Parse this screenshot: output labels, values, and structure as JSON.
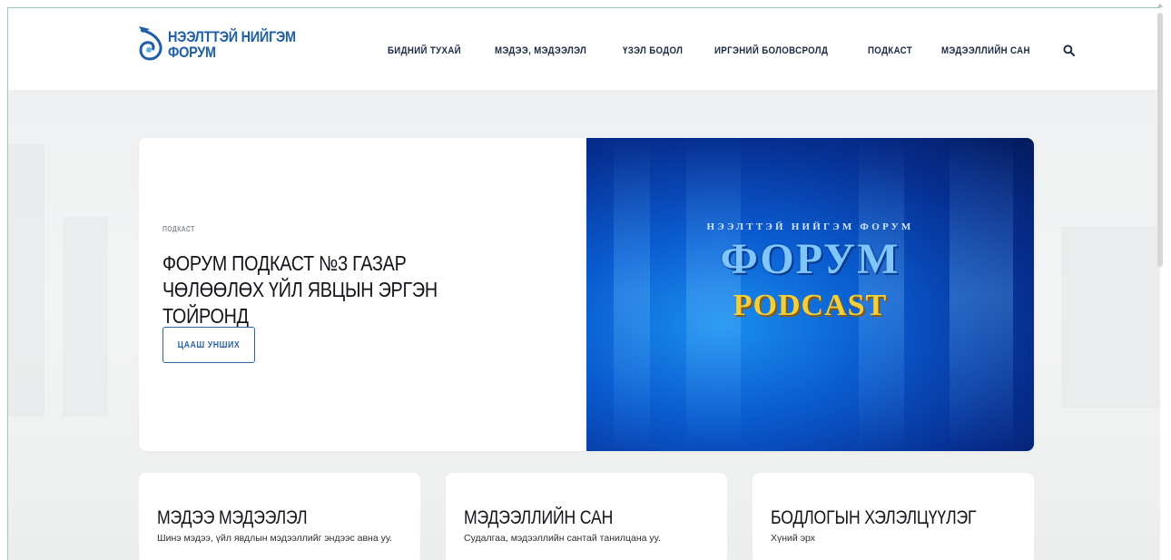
{
  "header": {
    "logo_line1": "НЭЭЛТТЭЙ НИЙГЭМ",
    "logo_line2": "ФОРУМ",
    "nav": [
      {
        "label": "БИДНИЙ ТУХАЙ"
      },
      {
        "label": "МЭДЭЭ, МЭДЭЭЛЭЛ"
      },
      {
        "label": "ҮЗЭЛ БОДОЛ"
      },
      {
        "label": "ИРГЭНИЙ БОЛОВСРОЛД"
      },
      {
        "label": "ПОДКАСТ"
      },
      {
        "label": "МЭДЭЭЛЛИЙН САН"
      }
    ],
    "search_icon": "search-icon"
  },
  "hero": {
    "kicker": "ПОДКАСТ",
    "title": "ФОРУМ ПОДКАСТ №3 ГАЗАР ЧӨЛӨӨЛӨХ ҮЙЛ ЯВЦЫН ЭРГЭН ТОЙРОНД",
    "button_label": "ЦААШ УНШИХ",
    "image": {
      "subtitle": "НЭЭЛТТЭЙ НИЙГЭМ ФОРУМ",
      "main": "ФОРУМ",
      "podcast": "PODCAST"
    }
  },
  "cards": [
    {
      "title": "МЭДЭЭ МЭДЭЭЛЭЛ",
      "text": "Шинэ мэдээ, үйл явдлын мэдээллийг эндээс авна уу."
    },
    {
      "title": "МЭДЭЭЛЛИЙН САН",
      "text": "Судалгаа, мэдээллийн сантай танилцана уу."
    },
    {
      "title": "БОДЛОГЫН ХЭЛЭЛЦҮҮЛЭГ",
      "text": "Хүний эрх"
    }
  ],
  "colors": {
    "brand": "#1f5fa8",
    "nav_text": "#1b2a44",
    "button_border": "#2b63a6",
    "podcast_yellow": "#f2cf3c"
  }
}
